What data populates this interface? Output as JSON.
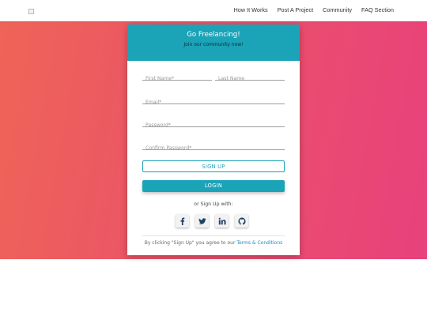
{
  "nav": {
    "items": [
      {
        "label": "How It Works"
      },
      {
        "label": "Post A Project"
      },
      {
        "label": "Community"
      },
      {
        "label": "FAQ Section"
      }
    ]
  },
  "card": {
    "title": "Go Freelancing!",
    "subtitle": "Join our community now!",
    "fields": {
      "first_name": {
        "placeholder": "First Name*",
        "value": ""
      },
      "last_name": {
        "placeholder": "Last Name",
        "value": ""
      },
      "email": {
        "placeholder": "Email*",
        "value": ""
      },
      "password": {
        "placeholder": "Password*",
        "value": ""
      },
      "confirm_password": {
        "placeholder": "Confirm Password*",
        "value": ""
      }
    },
    "signup_label": "SIGN UP",
    "login_label": "LOGIN",
    "or_text": "or Sign Up with:",
    "socials": [
      "facebook-icon",
      "twitter-icon",
      "linkedin-icon",
      "github-icon"
    ],
    "terms_prefix": "By clicking \"Sign Up\" you agree to our ",
    "terms_link": "Terms & Conditions"
  },
  "colors": {
    "accent": "#1ba3b8",
    "hero_start": "#ee6457",
    "hero_end": "#e8417c",
    "link": "#1b8ac4"
  }
}
